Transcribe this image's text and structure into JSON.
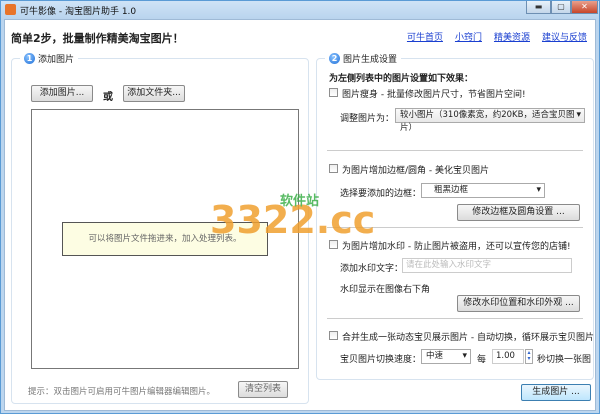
{
  "window": {
    "title": "可牛影像 - 淘宝图片助手 1.0",
    "minimize": "▬",
    "maximize": "▢",
    "close": "✕"
  },
  "header": {
    "headline": "简单2步，批量制作精美淘宝图片！",
    "links": [
      "可牛首页",
      "小窍门",
      "精美资源",
      "建议与反馈"
    ]
  },
  "left": {
    "number": "1",
    "title": "添加图片",
    "add_images": "添加图片...",
    "or": "或",
    "add_folder": "添加文件夹...",
    "drop_hint": "可以将图片文件拖进来，加入处理列表。",
    "footer_tip": "提示：双击图片可启用可牛图片编辑器编辑图片。",
    "clear_list": "清空列表"
  },
  "right": {
    "number": "2",
    "title": "图片生成设置",
    "intro": "为左侧列表中的图片设置如下效果：",
    "resize": {
      "label": "图片瘦身 - 批量修改图片尺寸，节省图片空间!",
      "checked": false,
      "field_label": "调整图片为：",
      "value": "较小图片（310像素宽，约20KB，适合宝贝图片）"
    },
    "border": {
      "label": "为图片增加边框/圆角 - 美化宝贝图片",
      "checked": false,
      "field_label": "选择要添加的边框：",
      "value": "粗黑边框",
      "button": "修改边框及圆角设置 ..."
    },
    "watermark": {
      "label": "为图片增加水印 - 防止图片被盗用，还可以宣传您的店铺!",
      "checked": false,
      "field_label": "添加水印文字：",
      "placeholder": "请在此处输入水印文字",
      "position_text": "水印显示在图像右下角",
      "button": "修改水印位置和水印外观 ..."
    },
    "merge": {
      "label": "合并生成一张动态宝贝展示图片 - 自动切换，循环展示宝贝图片",
      "checked": false,
      "speed_label": "宝贝图片切换速度：",
      "speed": "中速",
      "every": "每",
      "seconds": "1.00",
      "suffix": "秒切换一张图"
    }
  },
  "generate": "生成图片 ...",
  "watermark_logo": {
    "text": "3322.cc",
    "sub": "软件站"
  }
}
